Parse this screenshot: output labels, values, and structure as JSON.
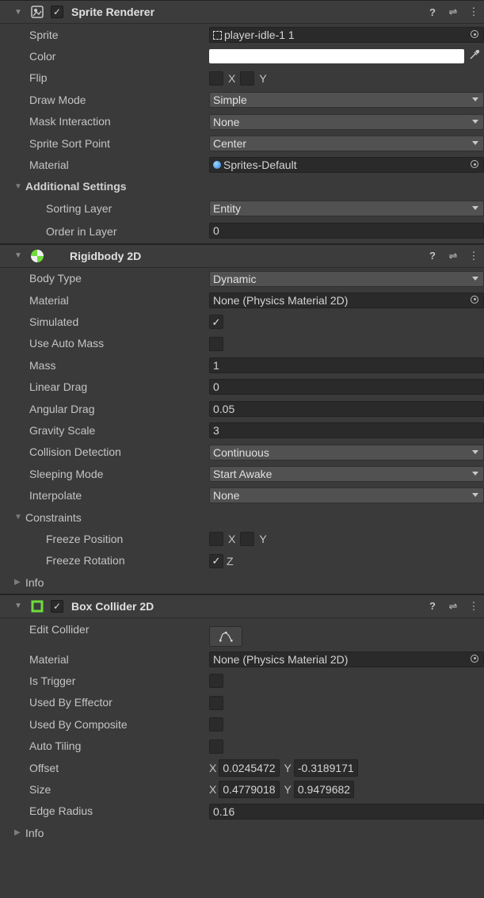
{
  "sprite_renderer": {
    "title": "Sprite Renderer",
    "enabled": true,
    "sprite_label": "Sprite",
    "sprite_value": "player-idle-1 1",
    "color_label": "Color",
    "color_value": "#ffffff",
    "flip_label": "Flip",
    "flip_x": "X",
    "flip_y": "Y",
    "draw_mode_label": "Draw Mode",
    "draw_mode_value": "Simple",
    "mask_label": "Mask Interaction",
    "mask_value": "None",
    "sort_point_label": "Sprite Sort Point",
    "sort_point_value": "Center",
    "material_label": "Material",
    "material_value": "Sprites-Default",
    "additional_label": "Additional Settings",
    "sorting_layer_label": "Sorting Layer",
    "sorting_layer_value": "Entity",
    "order_label": "Order in Layer",
    "order_value": "0"
  },
  "rigidbody": {
    "title": "Rigidbody 2D",
    "body_type_label": "Body Type",
    "body_type_value": "Dynamic",
    "material_label": "Material",
    "material_value": "None (Physics Material 2D)",
    "simulated_label": "Simulated",
    "simulated": true,
    "auto_mass_label": "Use Auto Mass",
    "auto_mass": false,
    "mass_label": "Mass",
    "mass_value": "1",
    "linear_drag_label": "Linear Drag",
    "linear_drag_value": "0",
    "angular_drag_label": "Angular Drag",
    "angular_drag_value": "0.05",
    "gravity_label": "Gravity Scale",
    "gravity_value": "3",
    "collision_label": "Collision Detection",
    "collision_value": "Continuous",
    "sleeping_label": "Sleeping Mode",
    "sleeping_value": "Start Awake",
    "interpolate_label": "Interpolate",
    "interpolate_value": "None",
    "constraints_label": "Constraints",
    "freeze_pos_label": "Freeze Position",
    "freeze_pos_x": "X",
    "freeze_pos_y": "Y",
    "freeze_rot_label": "Freeze Rotation",
    "freeze_rot_z": "Z",
    "info_label": "Info"
  },
  "box_collider": {
    "title": "Box Collider 2D",
    "enabled": true,
    "edit_label": "Edit Collider",
    "material_label": "Material",
    "material_value": "None (Physics Material 2D)",
    "is_trigger_label": "Is Trigger",
    "effector_label": "Used By Effector",
    "composite_label": "Used By Composite",
    "auto_tiling_label": "Auto Tiling",
    "offset_label": "Offset",
    "offset_x_lbl": "X",
    "offset_x": "0.0245472",
    "offset_y_lbl": "Y",
    "offset_y": "-0.3189171",
    "size_label": "Size",
    "size_x_lbl": "X",
    "size_x": "0.4779018",
    "size_y_lbl": "Y",
    "size_y": "0.9479682",
    "edge_radius_label": "Edge Radius",
    "edge_radius_value": "0.16",
    "info_label": "Info"
  },
  "check_glyph": "✓",
  "header_icons": {
    "help": "?",
    "presets": "⇌",
    "menu": "⋮"
  },
  "colors": {
    "panel": "#3a3a3a",
    "field": "#2a2a2a",
    "dropdown": "#515151",
    "accent_green": "#6fdc3c"
  }
}
